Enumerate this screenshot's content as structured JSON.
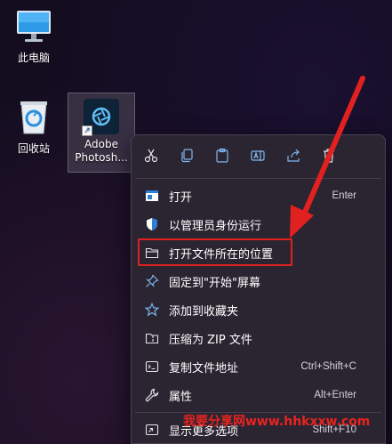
{
  "desktop": {
    "icons": [
      {
        "label": "此电脑",
        "icon": "monitor-icon"
      },
      {
        "label": "回收站",
        "icon": "recycle-bin-icon"
      },
      {
        "label_line1": "Adobe",
        "label_line2": "Photosh...",
        "icon": "photoshop-express-icon"
      }
    ]
  },
  "context_menu": {
    "toolbar": [
      {
        "name": "cut",
        "icon": "scissors-icon"
      },
      {
        "name": "copy",
        "icon": "copy-icon"
      },
      {
        "name": "paste",
        "icon": "paste-icon"
      },
      {
        "name": "rename",
        "icon": "rename-icon"
      },
      {
        "name": "share",
        "icon": "share-icon"
      },
      {
        "name": "delete",
        "icon": "trash-icon"
      }
    ],
    "items": [
      {
        "label": "打开",
        "shortcut": "Enter",
        "icon": "app-window-icon"
      },
      {
        "label": "以管理员身份运行",
        "shortcut": "",
        "icon": "shield-icon"
      },
      {
        "label": "打开文件所在的位置",
        "shortcut": "",
        "icon": "folder-icon"
      },
      {
        "label": "固定到\"开始\"屏幕",
        "shortcut": "",
        "icon": "pin-icon"
      },
      {
        "label": "添加到收藏夹",
        "shortcut": "",
        "icon": "star-icon"
      },
      {
        "label": "压缩为 ZIP 文件",
        "shortcut": "",
        "icon": "zip-folder-icon"
      },
      {
        "label": "复制文件地址",
        "shortcut": "Ctrl+Shift+C",
        "icon": "copy-path-icon"
      },
      {
        "label": "属性",
        "shortcut": "Alt+Enter",
        "icon": "wrench-icon"
      },
      {
        "label": "显示更多选项",
        "shortcut": "Shift+F10",
        "icon": "more-options-icon"
      }
    ]
  },
  "annotation": {
    "highlight_color": "#e0211f"
  },
  "watermark": {
    "text": "我要分享网www.hhkxxw.com"
  },
  "colors": {
    "menu_bg": "#2b2431",
    "accent_icon": "#7fb6f0",
    "desktop_bg": "#140d20"
  }
}
